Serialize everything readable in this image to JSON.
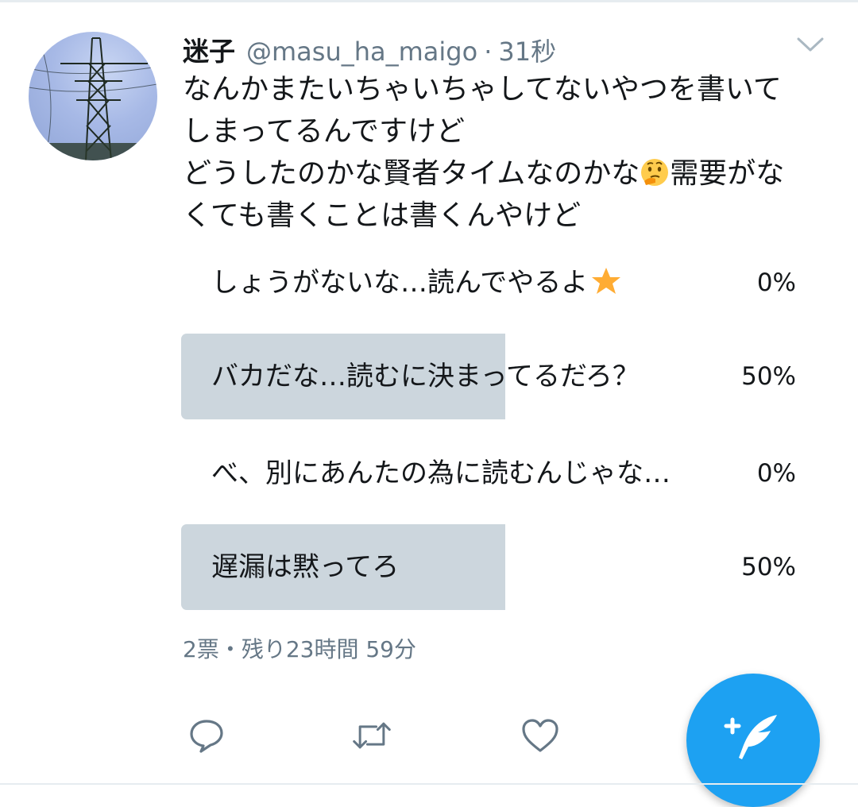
{
  "tweet": {
    "display_name": "迷子",
    "handle": "@masu_ha_maigo",
    "separator": "·",
    "time": "31秒",
    "text_lines": [
      "なんかまたいちゃいちゃしてないやつを書いて",
      "しまってるんですけど",
      "どうしたのかな賢者タイムなのかな",
      "需要がな",
      "くても書くことは書くんやけど"
    ]
  },
  "poll": {
    "options": [
      {
        "label": "しょうがないな…読んでやるよ",
        "percent_label": "0%",
        "percent": 0,
        "has_star": true
      },
      {
        "label": "バカだな…読むに決まってるだろ？",
        "percent_label": "50%",
        "percent": 50
      },
      {
        "label": "べ、別にあんたの為に読むんじゃな…",
        "percent_label": "0%",
        "percent": 0
      },
      {
        "label": "遅漏は黙ってろ",
        "percent_label": "50%",
        "percent": 50
      }
    ],
    "meta": "2票・残り23時間 59分"
  },
  "actions": [
    "reply-icon",
    "retweet-icon",
    "like-icon"
  ],
  "fab_icon": "compose-tweet-icon",
  "colors": {
    "accent": "#1da1f2",
    "poll_bar": "#ccd6dd",
    "secondary_text": "#657786",
    "primary_text": "#14171a"
  }
}
